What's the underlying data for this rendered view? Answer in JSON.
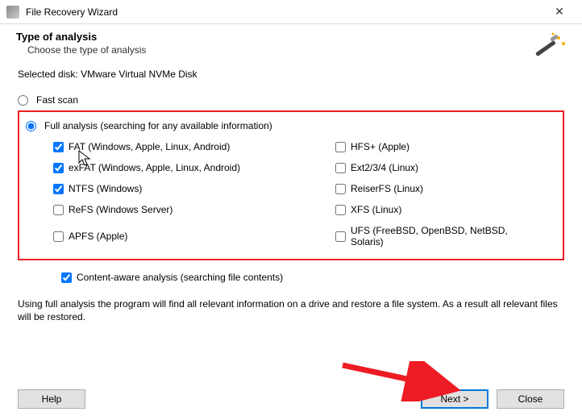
{
  "window": {
    "title": "File Recovery Wizard",
    "close_glyph": "✕"
  },
  "header": {
    "title": "Type of analysis",
    "subtitle": "Choose the type of analysis"
  },
  "selected_disk_label": "Selected disk:",
  "selected_disk_value": "VMware Virtual NVMe Disk",
  "scan": {
    "fast_label": "Fast scan",
    "full_label": "Full analysis (searching for any available information)"
  },
  "filesystems": {
    "left": [
      {
        "label": "FAT (Windows, Apple, Linux, Android)",
        "checked": true
      },
      {
        "label": "exFAT (Windows, Apple, Linux, Android)",
        "checked": true
      },
      {
        "label": "NTFS (Windows)",
        "checked": true
      },
      {
        "label": "ReFS (Windows Server)",
        "checked": false
      },
      {
        "label": "APFS (Apple)",
        "checked": false
      }
    ],
    "right": [
      {
        "label": "HFS+ (Apple)",
        "checked": false
      },
      {
        "label": "Ext2/3/4 (Linux)",
        "checked": false
      },
      {
        "label": "ReiserFS (Linux)",
        "checked": false
      },
      {
        "label": "XFS (Linux)",
        "checked": false
      },
      {
        "label": "UFS (FreeBSD, OpenBSD, NetBSD, Solaris)",
        "checked": false
      }
    ]
  },
  "content_aware_label": "Content-aware analysis (searching file contents)",
  "description": "Using full analysis the program will find all relevant information on a drive and restore a file system. As a result all relevant files will be restored.",
  "buttons": {
    "help": "Help",
    "next": "Next >",
    "close": "Close"
  }
}
